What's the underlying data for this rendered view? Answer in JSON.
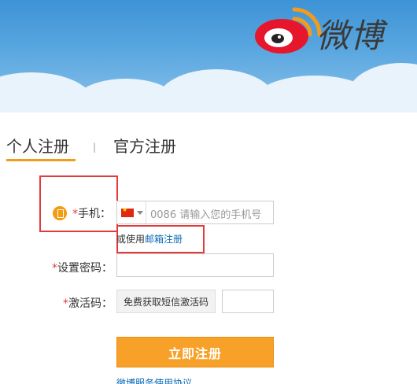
{
  "header": {
    "logo_text": "微博"
  },
  "tabs": {
    "personal": "个人注册",
    "separator": "|",
    "official": "官方注册"
  },
  "form": {
    "phone": {
      "required_mark": "*",
      "label": "手机：",
      "country_code_placeholder": "0086  请输入您的手机号"
    },
    "alt_register": {
      "prefix": "或使用",
      "link": "邮箱注册"
    },
    "password": {
      "required_mark": "*",
      "label": "设置密码："
    },
    "activation": {
      "required_mark": "*",
      "label": "激活码：",
      "sms_button": "免费获取短信激活码"
    },
    "submit_label": "立即注册",
    "terms_link": "微博服务使用协议"
  },
  "colors": {
    "accent": "#f7a128",
    "link": "#0a69b5",
    "required": "#e23b3b",
    "highlight_box": "#e23b3b"
  }
}
